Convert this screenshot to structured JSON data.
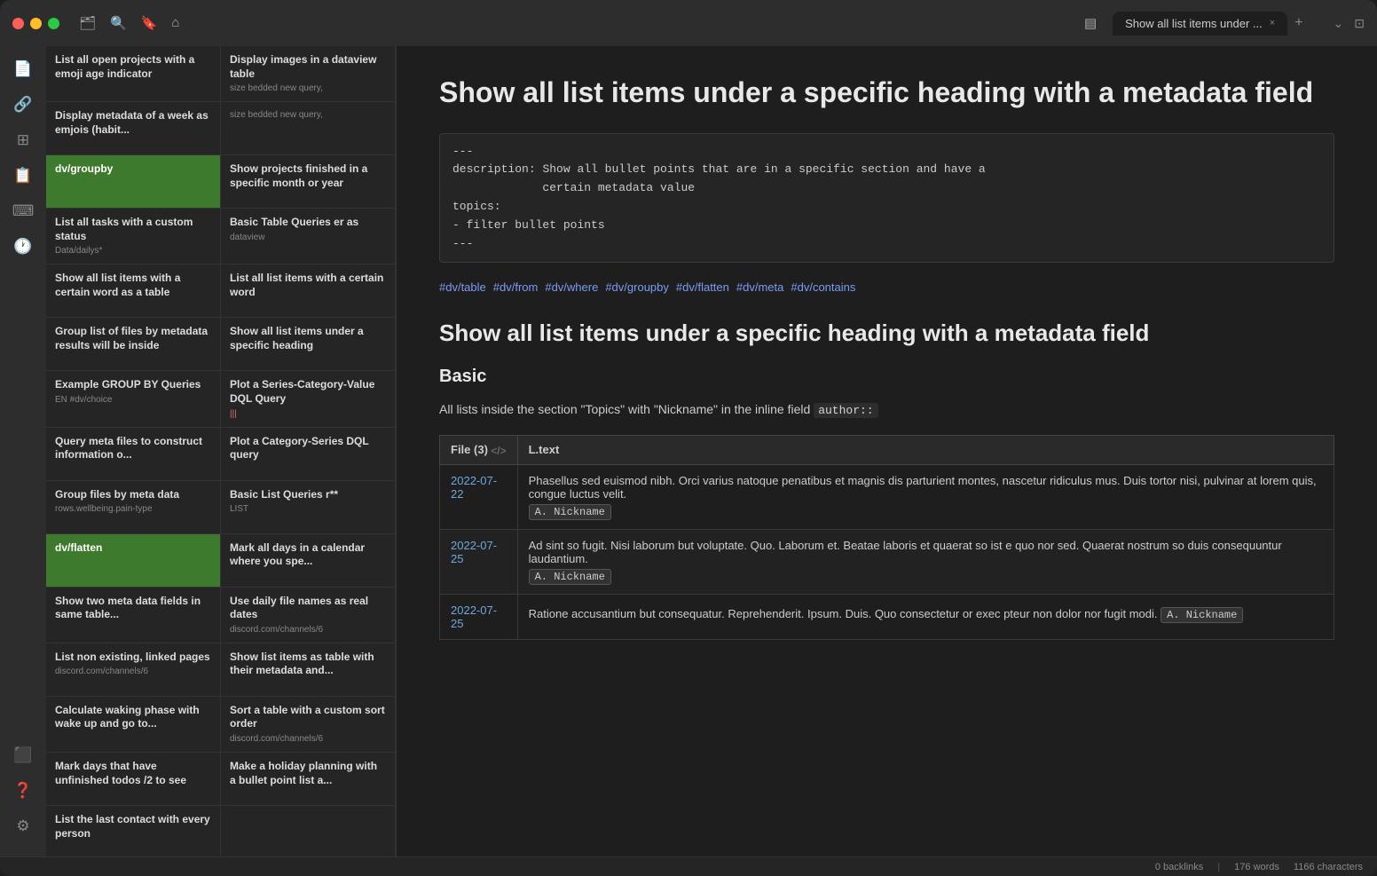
{
  "window": {
    "title": "Show all list items under ... ",
    "tab_close": "×",
    "tab_add": "+"
  },
  "activity_bar": {
    "icons": [
      "📄",
      "🔗",
      "⊞",
      "📋",
      "⌨",
      "🕐"
    ],
    "bottom_icons": [
      "⬛",
      "❓",
      "⚙"
    ]
  },
  "sidebar": {
    "items": [
      {
        "id": 1,
        "title": "List all open projects with a emoji age indicator",
        "subtitle": "Display images in a dataview table",
        "tag": "",
        "col": 0,
        "active": false
      },
      {
        "id": 2,
        "title": "Display metadata of a week as emjois (habit...",
        "subtitle": "size\nbedded\nnew query,",
        "tag": "",
        "col": 1,
        "active": false
      },
      {
        "id": 3,
        "title": "dv/groupby",
        "subtitle": "Show projects finished in a specific month or year",
        "tag": "",
        "col": 0,
        "active": true
      },
      {
        "id": 4,
        "title": "Show projects finished in a specific month or year",
        "subtitle": "",
        "tag": "",
        "col": 1,
        "active": false
      },
      {
        "id": 5,
        "title": "List all tasks with a custom status",
        "subtitle": "Basic Table Queries er as\ndataview",
        "tag": "",
        "col": 0,
        "active": false
      },
      {
        "id": 6,
        "title": "",
        "subtitle": "Data/dailys*",
        "tag": "",
        "col": 1,
        "active": false
      },
      {
        "id": 7,
        "title": "Show all list items with a certain word as a table",
        "subtitle": "List all list items with a certain word",
        "tag": "",
        "col": 0,
        "active": false
      },
      {
        "id": 8,
        "title": "",
        "subtitle": "",
        "tag": "",
        "col": 1,
        "active": false
      },
      {
        "id": 9,
        "title": "Group list of files by metadata results will be inside",
        "subtitle": "Show all list items under a specific heading",
        "tag": "",
        "col": 0,
        "active": false
      },
      {
        "id": 10,
        "title": "",
        "subtitle": "",
        "tag": "",
        "col": 1,
        "active": false
      },
      {
        "id": 11,
        "title": "Example GROUP BY Queries",
        "subtitle": "Plot a Series-Category-Value DQL Query",
        "tag": "",
        "col": 0,
        "active": false
      },
      {
        "id": 12,
        "title": "EN #dv/choice",
        "subtitle": "|||",
        "tag": "",
        "col": 1,
        "active": false
      },
      {
        "id": 13,
        "title": "Query meta files to construct information o...",
        "subtitle": "Plot a Category-Series DQL query",
        "tag": "",
        "col": 0,
        "active": false
      },
      {
        "id": 14,
        "title": "",
        "subtitle": "",
        "tag": "",
        "col": 1,
        "active": false
      },
      {
        "id": 15,
        "title": "Group files by meta data",
        "subtitle": "Basic List Queries r**\nLIST",
        "tag": "",
        "col": 0,
        "active": false
      },
      {
        "id": 16,
        "title": "rows.wellbeing.pain-type",
        "subtitle": "",
        "tag": "",
        "col": 1,
        "active": false
      },
      {
        "id": 17,
        "title": "dv/flatten",
        "subtitle": "Mark all days in a calendar where you spe...",
        "tag": "",
        "col": 0,
        "active": true,
        "green": true
      },
      {
        "id": 18,
        "title": "",
        "subtitle": "",
        "tag": "",
        "col": 1,
        "active": false
      },
      {
        "id": 19,
        "title": "Show two meta data fields in same table...",
        "subtitle": "Use daily file names as real dates",
        "tag": "",
        "col": 0,
        "active": false
      },
      {
        "id": 20,
        "title": "",
        "subtitle": "discord.com/channels/6",
        "tag": "",
        "col": 1,
        "active": false
      },
      {
        "id": 21,
        "title": "List non existing, linked pages",
        "subtitle": "Show list items as table with their metadata and...",
        "tag": "",
        "col": 0,
        "active": false
      },
      {
        "id": 22,
        "title": "discord.com/channels/6",
        "subtitle": "",
        "tag": "",
        "col": 1,
        "active": false
      },
      {
        "id": 23,
        "title": "Calculate waking phase with wake up and go to...",
        "subtitle": "Sort a table with a custom sort order",
        "tag": "",
        "col": 0,
        "active": false
      },
      {
        "id": 24,
        "title": "",
        "subtitle": "discord.com/channels/6",
        "tag": "",
        "col": 1,
        "active": false
      },
      {
        "id": 25,
        "title": "Mark days that have unfinished todos /2 to see",
        "subtitle": "Make a holiday planning with a bullet point list a...",
        "tag": "",
        "col": 0,
        "active": false
      },
      {
        "id": 26,
        "title": "",
        "subtitle": "",
        "tag": "",
        "col": 1,
        "active": false
      },
      {
        "id": 27,
        "title": "List the last contact with every person",
        "subtitle": "",
        "tag": "",
        "col": 0,
        "active": false
      }
    ]
  },
  "content": {
    "main_title": "Show all list items under a specific heading with a metadata field",
    "frontmatter": {
      "dashes_top": "---",
      "description_label": "description:",
      "description_text": "Show all bullet points that are in a specific section and have a\ncertain metadata value",
      "topics_label": "topics:",
      "topics_item": "  - filter bullet points",
      "dashes_bottom": "---"
    },
    "tags": [
      "#dv/table",
      "#dv/from",
      "#dv/where",
      "#dv/groupby",
      "#dv/flatten",
      "#dv/meta",
      "#dv/contains"
    ],
    "section_title": "Show all list items under a specific heading with a metadata field",
    "subsection": "Basic",
    "intro_text": "All lists inside the section \"Topics\" with \"Nickname\" in the inline field",
    "inline_field": "author::",
    "table": {
      "headers": [
        "File (3)",
        "L.text"
      ],
      "rows": [
        {
          "file_link": "2022-07-22",
          "text": "Phasellus sed euismod nibh. Orci varius natoque penatibus et magnis dis parturient montes, nascetur ridiculus mus. Duis tortor nisi, pulvinar at lorem quis, congue luctus velit.",
          "badge": "A. Nickname"
        },
        {
          "file_link": "2022-07-25",
          "text": "Ad sint so fugit. Nisi laborum but voluptate. Quo. Laborum et. Beatae laboris et quaerat so ist e quo nor sed. Quaerat nostrum so duis consequuntur laudantium.",
          "badge": "A. Nickname"
        },
        {
          "file_link": "2022-07-25",
          "text": "Ratione accusantium but consequatur. Reprehenderit. Ipsum. Duis. Quo consectetur or exec pteur non dolor nor fugit modi.",
          "badge": "A. Nickname"
        }
      ]
    }
  },
  "statusbar": {
    "backlinks": "0 backlinks",
    "words": "176 words",
    "characters": "1166 characters"
  }
}
